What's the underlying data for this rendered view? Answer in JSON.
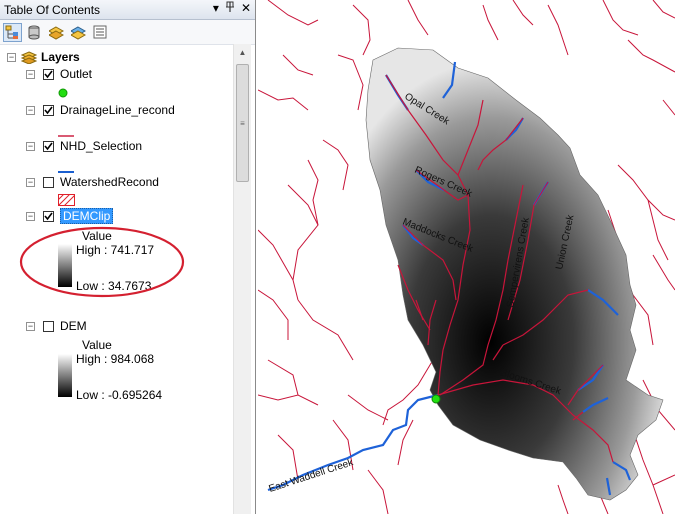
{
  "toc": {
    "title": "Table Of Contents",
    "title_buttons": [
      "▾",
      "📌",
      "✕"
    ],
    "toolbar": [
      {
        "name": "list-by-drawing-order",
        "active": true
      },
      {
        "name": "list-by-source"
      },
      {
        "name": "list-by-visibility"
      },
      {
        "name": "list-by-selection"
      },
      {
        "name": "options"
      }
    ],
    "root": {
      "label": "Layers"
    },
    "layers": [
      {
        "label": "Outlet",
        "checked": true,
        "symbol": "green-dot",
        "color": "#22dd11"
      },
      {
        "label": "DrainageLine_recond",
        "checked": true,
        "symbol": "line",
        "color": "#cc2244"
      },
      {
        "label": "NHD_Selection",
        "checked": true,
        "symbol": "line",
        "color": "#1a5fd0"
      },
      {
        "label": "WatershedRecond",
        "checked": false,
        "symbol": "hatch",
        "color": "#e0202a"
      },
      {
        "label": "DEMClip",
        "checked": true,
        "selected": true,
        "symbol": "ramp",
        "legend": {
          "field": "Value",
          "high": "High : 741.717",
          "low": "Low : 34.7673"
        }
      },
      {
        "label": "DEM",
        "checked": false,
        "symbol": "ramp",
        "legend": {
          "field": "Value",
          "high": "High : 984.068",
          "low": "Low : -0.695264"
        }
      }
    ],
    "annotation_color": "#d42030"
  },
  "map": {
    "stream_labels": [
      "Opal Creek",
      "Rogers Creek",
      "Maddocks Creek",
      "Sempervirens Creek",
      "Union Creek",
      "Blooms Creek",
      "East Waddell Creek"
    ],
    "colors": {
      "drainage": "#c8153a",
      "nhd": "#1e62d8",
      "outlet": "#22e011"
    }
  }
}
